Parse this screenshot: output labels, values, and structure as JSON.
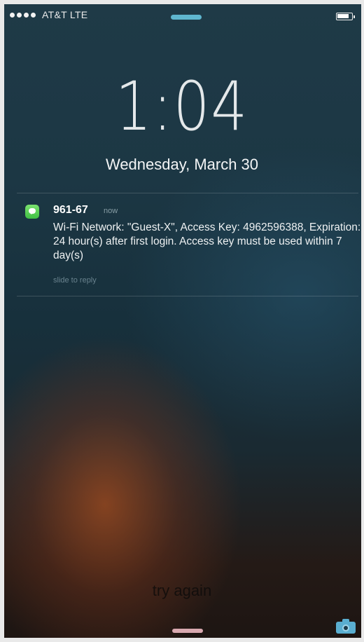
{
  "status_bar": {
    "carrier": "AT&T  LTE",
    "signal_icon": "signal-dots-icon",
    "battery_icon": "battery-icon"
  },
  "lock_screen": {
    "time": "1:04",
    "date": "Wednesday, March 30"
  },
  "notification": {
    "app_icon": "messages-icon",
    "sender": "961-67",
    "timestamp": "now",
    "body": "Wi-Fi Network: \"Guest-X\", Access Key: 4962596388, Expiration: 24 hour(s) after first login. Access key must be used within 7 day(s)",
    "action_hint": "slide to reply"
  },
  "overlay_text": "try again",
  "camera_icon": "camera-icon",
  "colors": {
    "messages_green": "#4cd150",
    "accent_blue": "#5aaed0"
  }
}
